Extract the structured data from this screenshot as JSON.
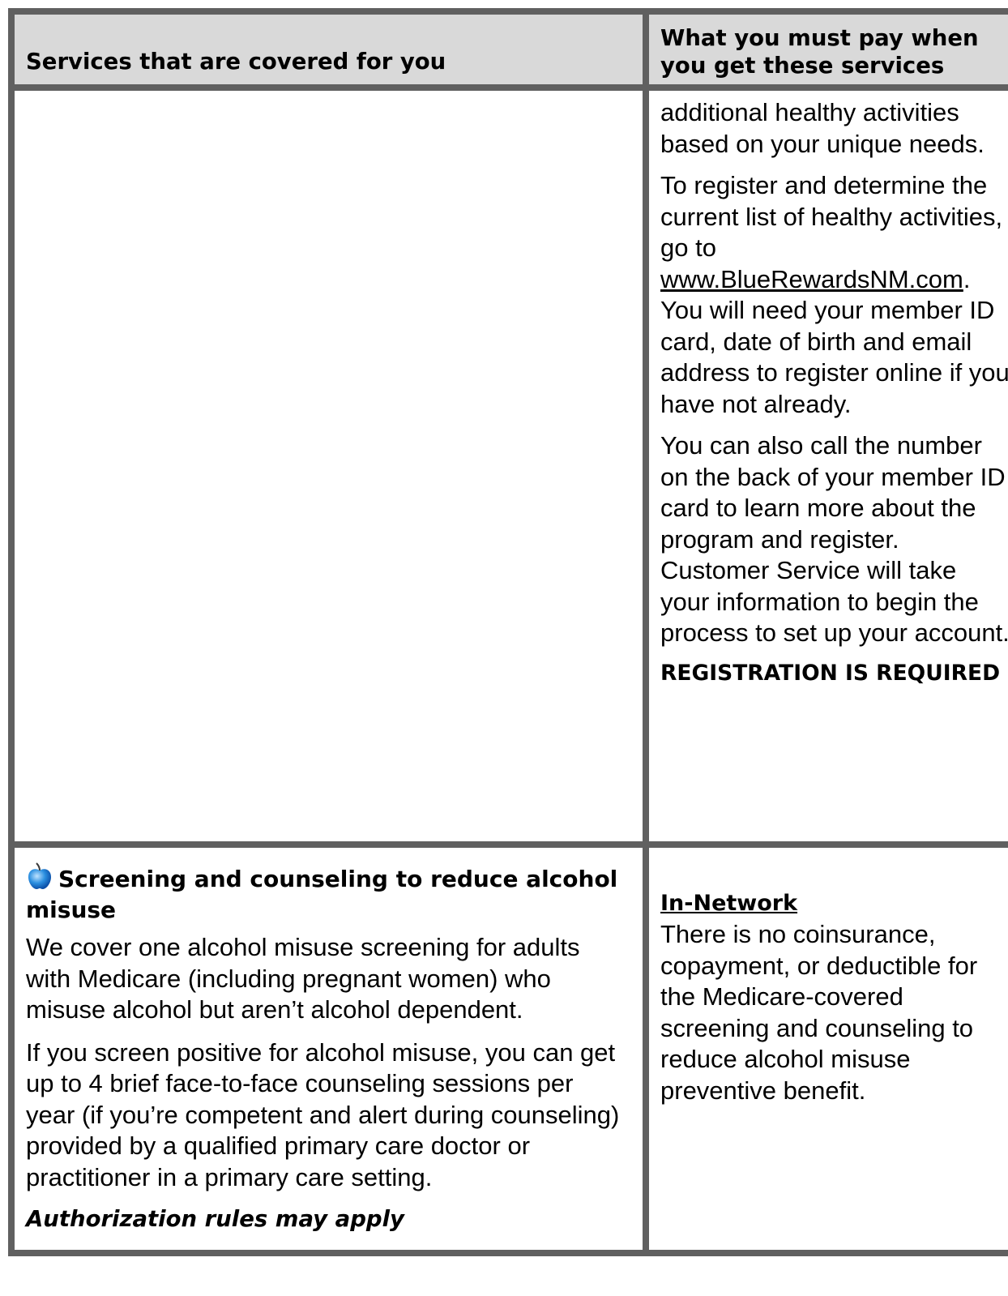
{
  "header": {
    "col1": "Services that are covered for you",
    "col2": "What you must pay when you get these services"
  },
  "row1": {
    "p1": "additional healthy activities based on your unique needs.",
    "p2_before": "To register and determine the current list of healthy activities, go to ",
    "p2_link": "www.BlueRewardsNM.com",
    "p2_after": ". You will need your member ID card, date of birth and email address to register online if you have not already.",
    "p3": "You can also call the number on the back of your member ID card to learn more about the program and register. Customer Service will take your information to begin the process to set up your account.",
    "p4": "REGISTRATION IS REQUIRED"
  },
  "row2": {
    "icon": "apple-icon",
    "title": "Screening and counseling to reduce alcohol misuse",
    "p1": "We cover one alcohol misuse screening for adults with Medicare (including pregnant women) who misuse alcohol but aren’t alcohol dependent.",
    "p2": "If you screen positive for alcohol misuse, you can get up to 4 brief face-to-face counseling sessions per year (if you’re competent and alert during counseling) provided by a qualified primary care doctor or practitioner in a primary care setting.",
    "auth": "Authorization rules may apply",
    "network_label": "In-Network",
    "network_text": "There is no coinsurance, copayment, or deductible for the Medicare-covered screening and counseling to reduce alcohol misuse preventive benefit."
  }
}
